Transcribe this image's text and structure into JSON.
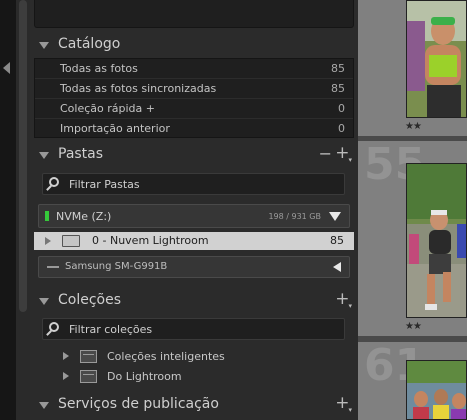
{
  "catalog": {
    "title": "Catálogo",
    "items": [
      {
        "label": "Todas as fotos",
        "count": "85"
      },
      {
        "label": "Todas as fotos sincronizadas",
        "count": "85"
      },
      {
        "label": "Coleção rápida +",
        "count": "0"
      },
      {
        "label": "Importação anterior",
        "count": "0"
      }
    ]
  },
  "folders": {
    "title": "Pastas",
    "minus": "−",
    "plus": "+",
    "filter_label": "Filtrar Pastas",
    "volume": {
      "name": "NVMe (Z:)",
      "size": "198 / 931 GB",
      "status_color": "#35c93a"
    },
    "folder": {
      "name": "0 - Nuvem Lightroom",
      "count": "85"
    },
    "device": {
      "name": "Samsung SM-G991B"
    }
  },
  "collections": {
    "title": "Coleções",
    "plus": "+",
    "filter_label": "Filtrar coleções",
    "items": [
      {
        "label": "Coleções inteligentes"
      },
      {
        "label": "Do Lightroom"
      }
    ]
  },
  "publish": {
    "title": "Serviços de publicação",
    "plus": "+"
  },
  "grid": {
    "cells": [
      {
        "number": "",
        "stars": "★★"
      },
      {
        "number": "55",
        "stars": "★★"
      },
      {
        "number": "61",
        "stars": ""
      }
    ]
  },
  "colors": {
    "accent_selected": "#d1d1d1",
    "panel_bg": "#2b2b2b",
    "grid_cell": "#808080"
  }
}
